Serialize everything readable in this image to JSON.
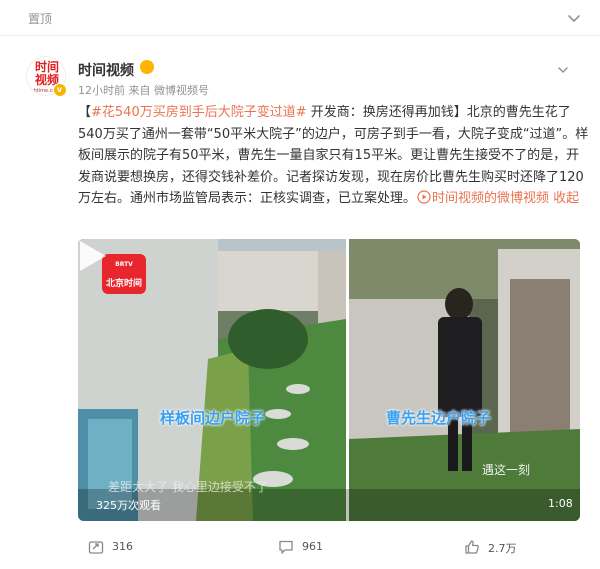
{
  "topbar": {
    "label": "置顶"
  },
  "author": {
    "name": "时间视频",
    "avatar_line1": "时间",
    "avatar_line2": "视频",
    "avatar_line3": "btime.com",
    "verified": "v",
    "time": "12小时前",
    "source_prefix": "来自",
    "source": "微博视频号"
  },
  "post": {
    "text_before": "【",
    "hashtag": "#花540万买房到手后大院子变过道#",
    "text_main": " 开发商：换房还得再加钱】北京的曹先生花了540万买了通州一套带“50平米大院子”的边户，可房子到手一看，大院子变成“过道”。样板间展示的院子有50平米，曹先生一量自家只有15平米。更让曹先生接受不了的是，开发商说要想换房，还得交钱补差价。记者探访发现，现在房价比曹先生购买时还降了120万左右。通州市场监管局表示：正核实调查，已立案处理。",
    "video_link": "时间视频的微博视频",
    "collapse": "收起"
  },
  "video": {
    "logo_top": "BRTV",
    "logo_bottom": "北京时间",
    "caption_left": "样板间边户院子",
    "caption_right": "曹先生边户院子",
    "subtitle_left": "差距太大了 我心里边接受不了",
    "subtitle_right": "遇这一刻",
    "views": "325万次观看",
    "duration": "1:08"
  },
  "actions": {
    "repost": "316",
    "comment": "961",
    "like": "2.7万"
  },
  "colors": {
    "link": "#eb7350",
    "caption": "#3aa0f0",
    "logo": "#e8262e"
  }
}
